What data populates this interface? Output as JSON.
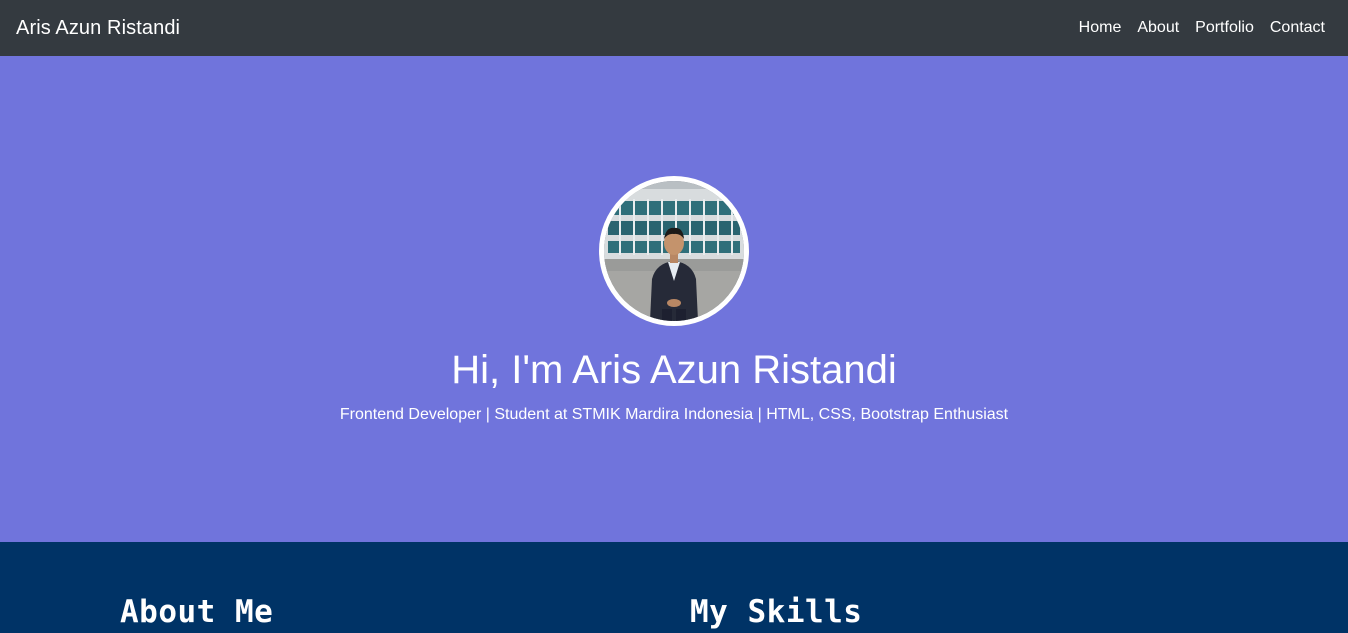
{
  "navbar": {
    "brand": "Aris Azun Ristandi",
    "links": [
      {
        "label": "Home"
      },
      {
        "label": "About"
      },
      {
        "label": "Portfolio"
      },
      {
        "label": "Contact"
      }
    ]
  },
  "hero": {
    "title": "Hi, I'm Aris Azun Ristandi",
    "subtitle": "Frontend Developer | Student at STMIK Mardira Indonesia | HTML, CSS, Bootstrap Enthusiast",
    "avatar_icon": "profile-photo"
  },
  "sections": {
    "about_heading": "About Me",
    "skills_heading": "My Skills"
  },
  "colors": {
    "navbar_bg": "#343a40",
    "hero_bg": "#7074dc",
    "about_bg": "#003366",
    "text": "#ffffff"
  }
}
